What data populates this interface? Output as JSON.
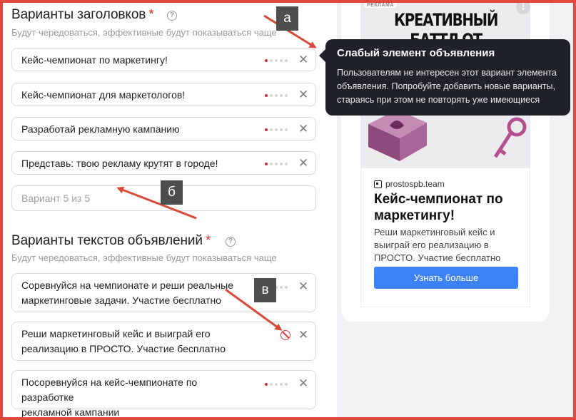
{
  "headlines": {
    "title": "Варианты заголовков",
    "required_mark": "*",
    "help": "?",
    "subtitle": "Будут чередоваться, эффективные будут показываться чаще",
    "items": [
      {
        "text": "Кейс-чемпионат по маркетингу!"
      },
      {
        "text": "Кейс-чемпионат для маркетологов!"
      },
      {
        "text": "Разработай рекламную кампанию"
      },
      {
        "text": "Представь: твою рекламу крутят в городе!"
      }
    ],
    "placeholder": "Вариант 5 из 5"
  },
  "texts": {
    "title": "Варианты текстов объявлений",
    "required_mark": "*",
    "help": "?",
    "subtitle": "Будут чередоваться, эффективные будут показываться чаще",
    "items": [
      {
        "line1": "Соревнуйся на чемпионате и реши реальные",
        "line2": "маркетинговые задачи. Участие бесплатно"
      },
      {
        "line1": "Реши маркетинговый кейс и выиграй его",
        "line2": "реализацию в ПРОСТО. Участие бесплатно"
      },
      {
        "line1": "Посоревнуйся на кейс-чемпионате по разработке",
        "line2": "рекламной кампании"
      }
    ]
  },
  "tooltip": {
    "title": "Слабый элемент объявления",
    "body": "Пользователям не интересен этот вариант элемента объявления. Попробуйте добавить новые варианты, стараясь при этом не повторять уже имеющиеся"
  },
  "preview": {
    "ad_tag": "РЕКЛАМА",
    "banner_text": "КРЕАТИВНЫЙ БАТТЛ ОТ",
    "more": "⋮",
    "domain": "prostospb.team",
    "headline": "Кейс-чемпионат по маркетингу!",
    "body": "Реши маркетинговый кейс и выиграй его реализацию в ПРОСТО. Участие бесплатно",
    "button": "Узнать больше"
  },
  "annotations": {
    "a": "а",
    "b": "б",
    "c": "в"
  },
  "colors": {
    "accent_red": "#e04a3f",
    "tooltip_bg": "#1f2229",
    "button_blue": "#3d82f6",
    "weak_dot": "#c72e2a"
  },
  "icons": {
    "close": "close-icon",
    "help": "help-icon",
    "weak": "no-entry-icon"
  }
}
